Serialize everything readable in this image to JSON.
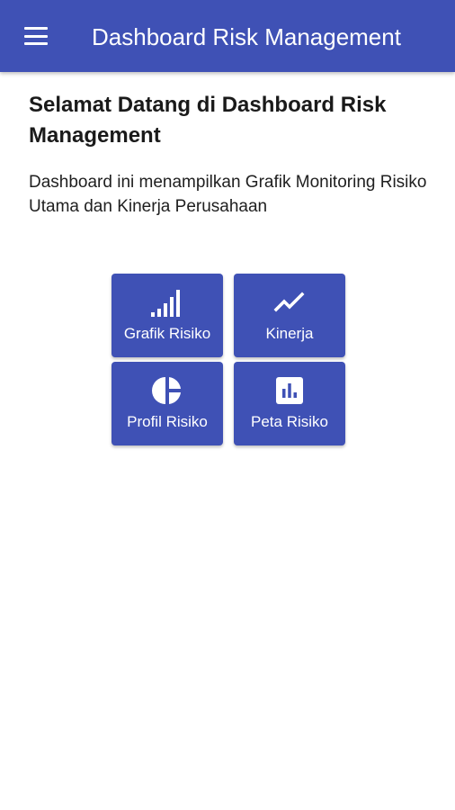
{
  "appbar": {
    "title": "Dashboard Risk Management",
    "menu_icon": "menu-icon",
    "color": "#3f51b5"
  },
  "main": {
    "heading": "Selamat Datang di Dashboard Risk Management",
    "description": "Dashboard ini menampilkan Grafik Monitoring Risiko Utama dan Kinerja Perusahaan"
  },
  "tiles": [
    {
      "label": "Grafik Risiko",
      "icon": "signal-bars-icon"
    },
    {
      "label": "Kinerja",
      "icon": "trending-up-icon"
    },
    {
      "label": "Profil Risiko",
      "icon": "pie-chart-icon"
    },
    {
      "label": "Peta Risiko",
      "icon": "bar-chart-box-icon"
    }
  ]
}
